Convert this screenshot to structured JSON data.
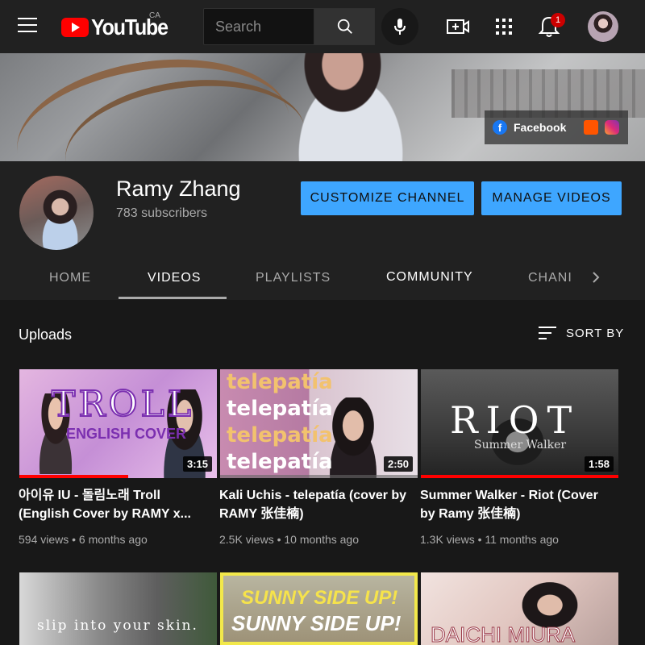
{
  "header": {
    "logo_text": "YouTube",
    "country_code": "CA",
    "search_placeholder": "Search",
    "notification_count": "1"
  },
  "banner": {
    "social_links": [
      {
        "label": "Facebook",
        "icon": "facebook-icon"
      },
      {
        "label": "",
        "icon": "soundcloud-icon"
      },
      {
        "label": "",
        "icon": "instagram-icon"
      }
    ]
  },
  "channel": {
    "name": "Ramy Zhang",
    "subscribers": "783 subscribers",
    "customize_label": "CUSTOMIZE CHANNEL",
    "manage_label": "MANAGE VIDEOS"
  },
  "tabs": [
    {
      "label": "HOME"
    },
    {
      "label": "VIDEOS"
    },
    {
      "label": "PLAYLISTS"
    },
    {
      "label": "COMMUNITY"
    },
    {
      "label": "CHANI"
    }
  ],
  "uploads": {
    "title": "Uploads",
    "sort_label": "SORT BY"
  },
  "videos": [
    {
      "title": "아이유 IU - 돌림노래 Troll (English Cover by RAMY x...",
      "duration": "3:15",
      "meta": "594 views • 6 months ago",
      "progress": 0.55,
      "thumb_text": "TROLL",
      "thumb_subtext": "ENGLISH COVER"
    },
    {
      "title": "Kali Uchis - telepatía (cover by RAMY 张佳楠)",
      "duration": "2:50",
      "meta": "2.5K views • 10 months ago",
      "progress": 0.0,
      "thumb_text": "telepatía",
      "thumb_subtext": ""
    },
    {
      "title": "Summer Walker - Riot (Cover by Ramy 张佳楠)",
      "duration": "1:58",
      "meta": "1.3K views • 11 months ago",
      "progress": 1.0,
      "thumb_text": "RIOT",
      "thumb_subtext": "Summer Walker"
    },
    {
      "title": "",
      "duration": "",
      "meta": "",
      "progress": 0,
      "thumb_text": "slip into your skin.",
      "thumb_subtext": ""
    },
    {
      "title": "",
      "duration": "",
      "meta": "",
      "progress": 0,
      "thumb_text": "SUNNY SIDE UP!",
      "thumb_subtext": ""
    },
    {
      "title": "",
      "duration": "",
      "meta": "",
      "progress": 0,
      "thumb_text": "DAICHI MIURA",
      "thumb_subtext": ""
    }
  ]
}
